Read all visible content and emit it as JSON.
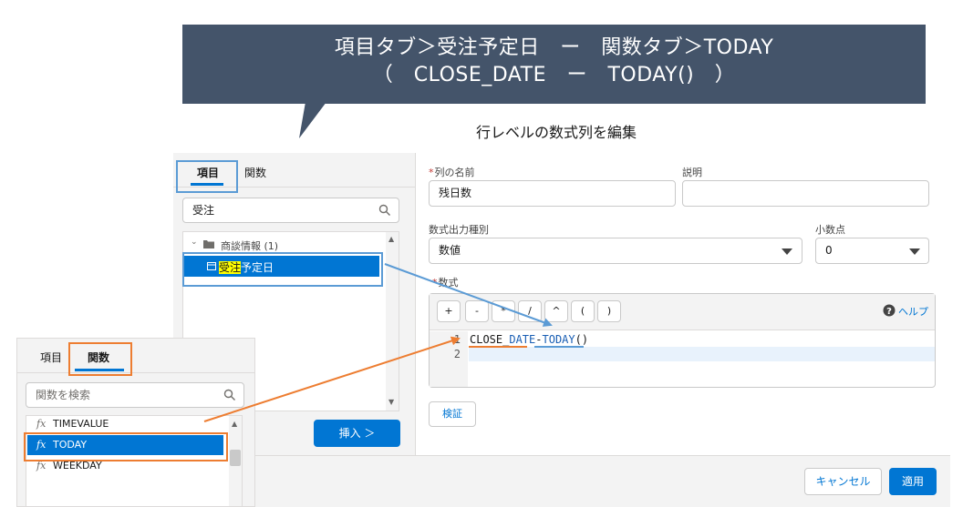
{
  "callout": {
    "line1": "項目タブ＞受注予定日　ー　関数タブ＞TODAY",
    "line2": "（　CLOSE_DATE　ー　TODAY()　）"
  },
  "modal": {
    "title": "行レベルの数式列を編集",
    "left": {
      "tabs": [
        "項目",
        "関数"
      ],
      "active_tab": "項目",
      "search_value": "受注",
      "tree": {
        "group_label": "商談情報 (1)",
        "item_highlight": "受注",
        "item_rest": "予定日"
      },
      "insert_label": "挿入 ＞"
    },
    "right": {
      "column_name_label": "列の名前",
      "column_name_value": "残日数",
      "description_label": "説明",
      "output_type_label": "数式出力種別",
      "output_type_value": "数値",
      "decimal_label": "小数点",
      "decimal_value": "0",
      "formula_label": "数式",
      "operators": [
        "+",
        "-",
        "*",
        "/",
        "^",
        "(",
        ")"
      ],
      "help_label": "ヘルプ",
      "code_line1": {
        "a": "CLOSE",
        "b": "DATE",
        "op": "-",
        "c": "TODAY",
        "paren": "()"
      },
      "line_numbers": [
        "1",
        "2"
      ],
      "validate_label": "検証"
    },
    "footer": {
      "cancel_label": "キャンセル",
      "apply_label": "適用"
    }
  },
  "overlay": {
    "tabs": [
      "項目",
      "関数"
    ],
    "active_tab": "関数",
    "search_placeholder": "関数を検索",
    "functions": [
      "TIMEVALUE",
      "TODAY",
      "WEEKDAY"
    ],
    "selected": "TODAY"
  },
  "colors": {
    "brand": "#0176d3",
    "callout": "#44546a",
    "highlight_blue": "#5b9bd5",
    "highlight_orange": "#ed7d31",
    "search_hit": "#ffff00"
  }
}
